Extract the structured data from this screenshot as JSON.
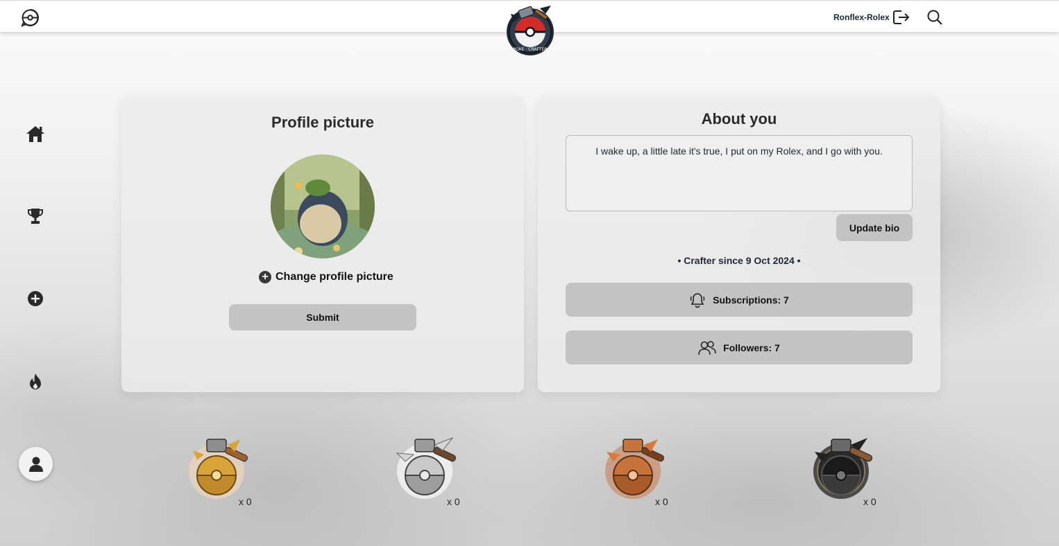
{
  "header": {
    "username": "Ronflex-Rolex",
    "brand_logo_text": "POKE · CRAFTER",
    "icons": [
      "pokeball-chat-icon",
      "logout-icon",
      "search-icon"
    ]
  },
  "sidebar": {
    "items": [
      {
        "icon": "home-icon"
      },
      {
        "icon": "trophy-icon"
      },
      {
        "icon": "plus-circle-icon"
      },
      {
        "icon": "flame-icon"
      },
      {
        "icon": "user-icon",
        "active": true
      }
    ]
  },
  "profile_card": {
    "title": "Profile picture",
    "change_label": "Change profile picture",
    "submit_label": "Submit"
  },
  "about_card": {
    "title": "About you",
    "bio": "I wake up, a little late it's true, I put on my Rolex, and I go with you.",
    "update_label": "Update bio",
    "since": "• Crafter since 9 Oct 2024 •",
    "subscriptions_label": "Subscriptions: 7",
    "followers_label": "Followers: 7"
  },
  "badges": [
    {
      "tier": "gold",
      "count": "x 0",
      "color": "#d9a53a"
    },
    {
      "tier": "silver",
      "count": "x 0",
      "color": "#b9b9b9"
    },
    {
      "tier": "bronze",
      "count": "x 0",
      "color": "#c9733c"
    },
    {
      "tier": "black",
      "count": "x 0",
      "color": "#2a2a2a"
    }
  ],
  "colors": {
    "button_bg": "#c3c3c3",
    "card_bg": "#ebebeb"
  }
}
